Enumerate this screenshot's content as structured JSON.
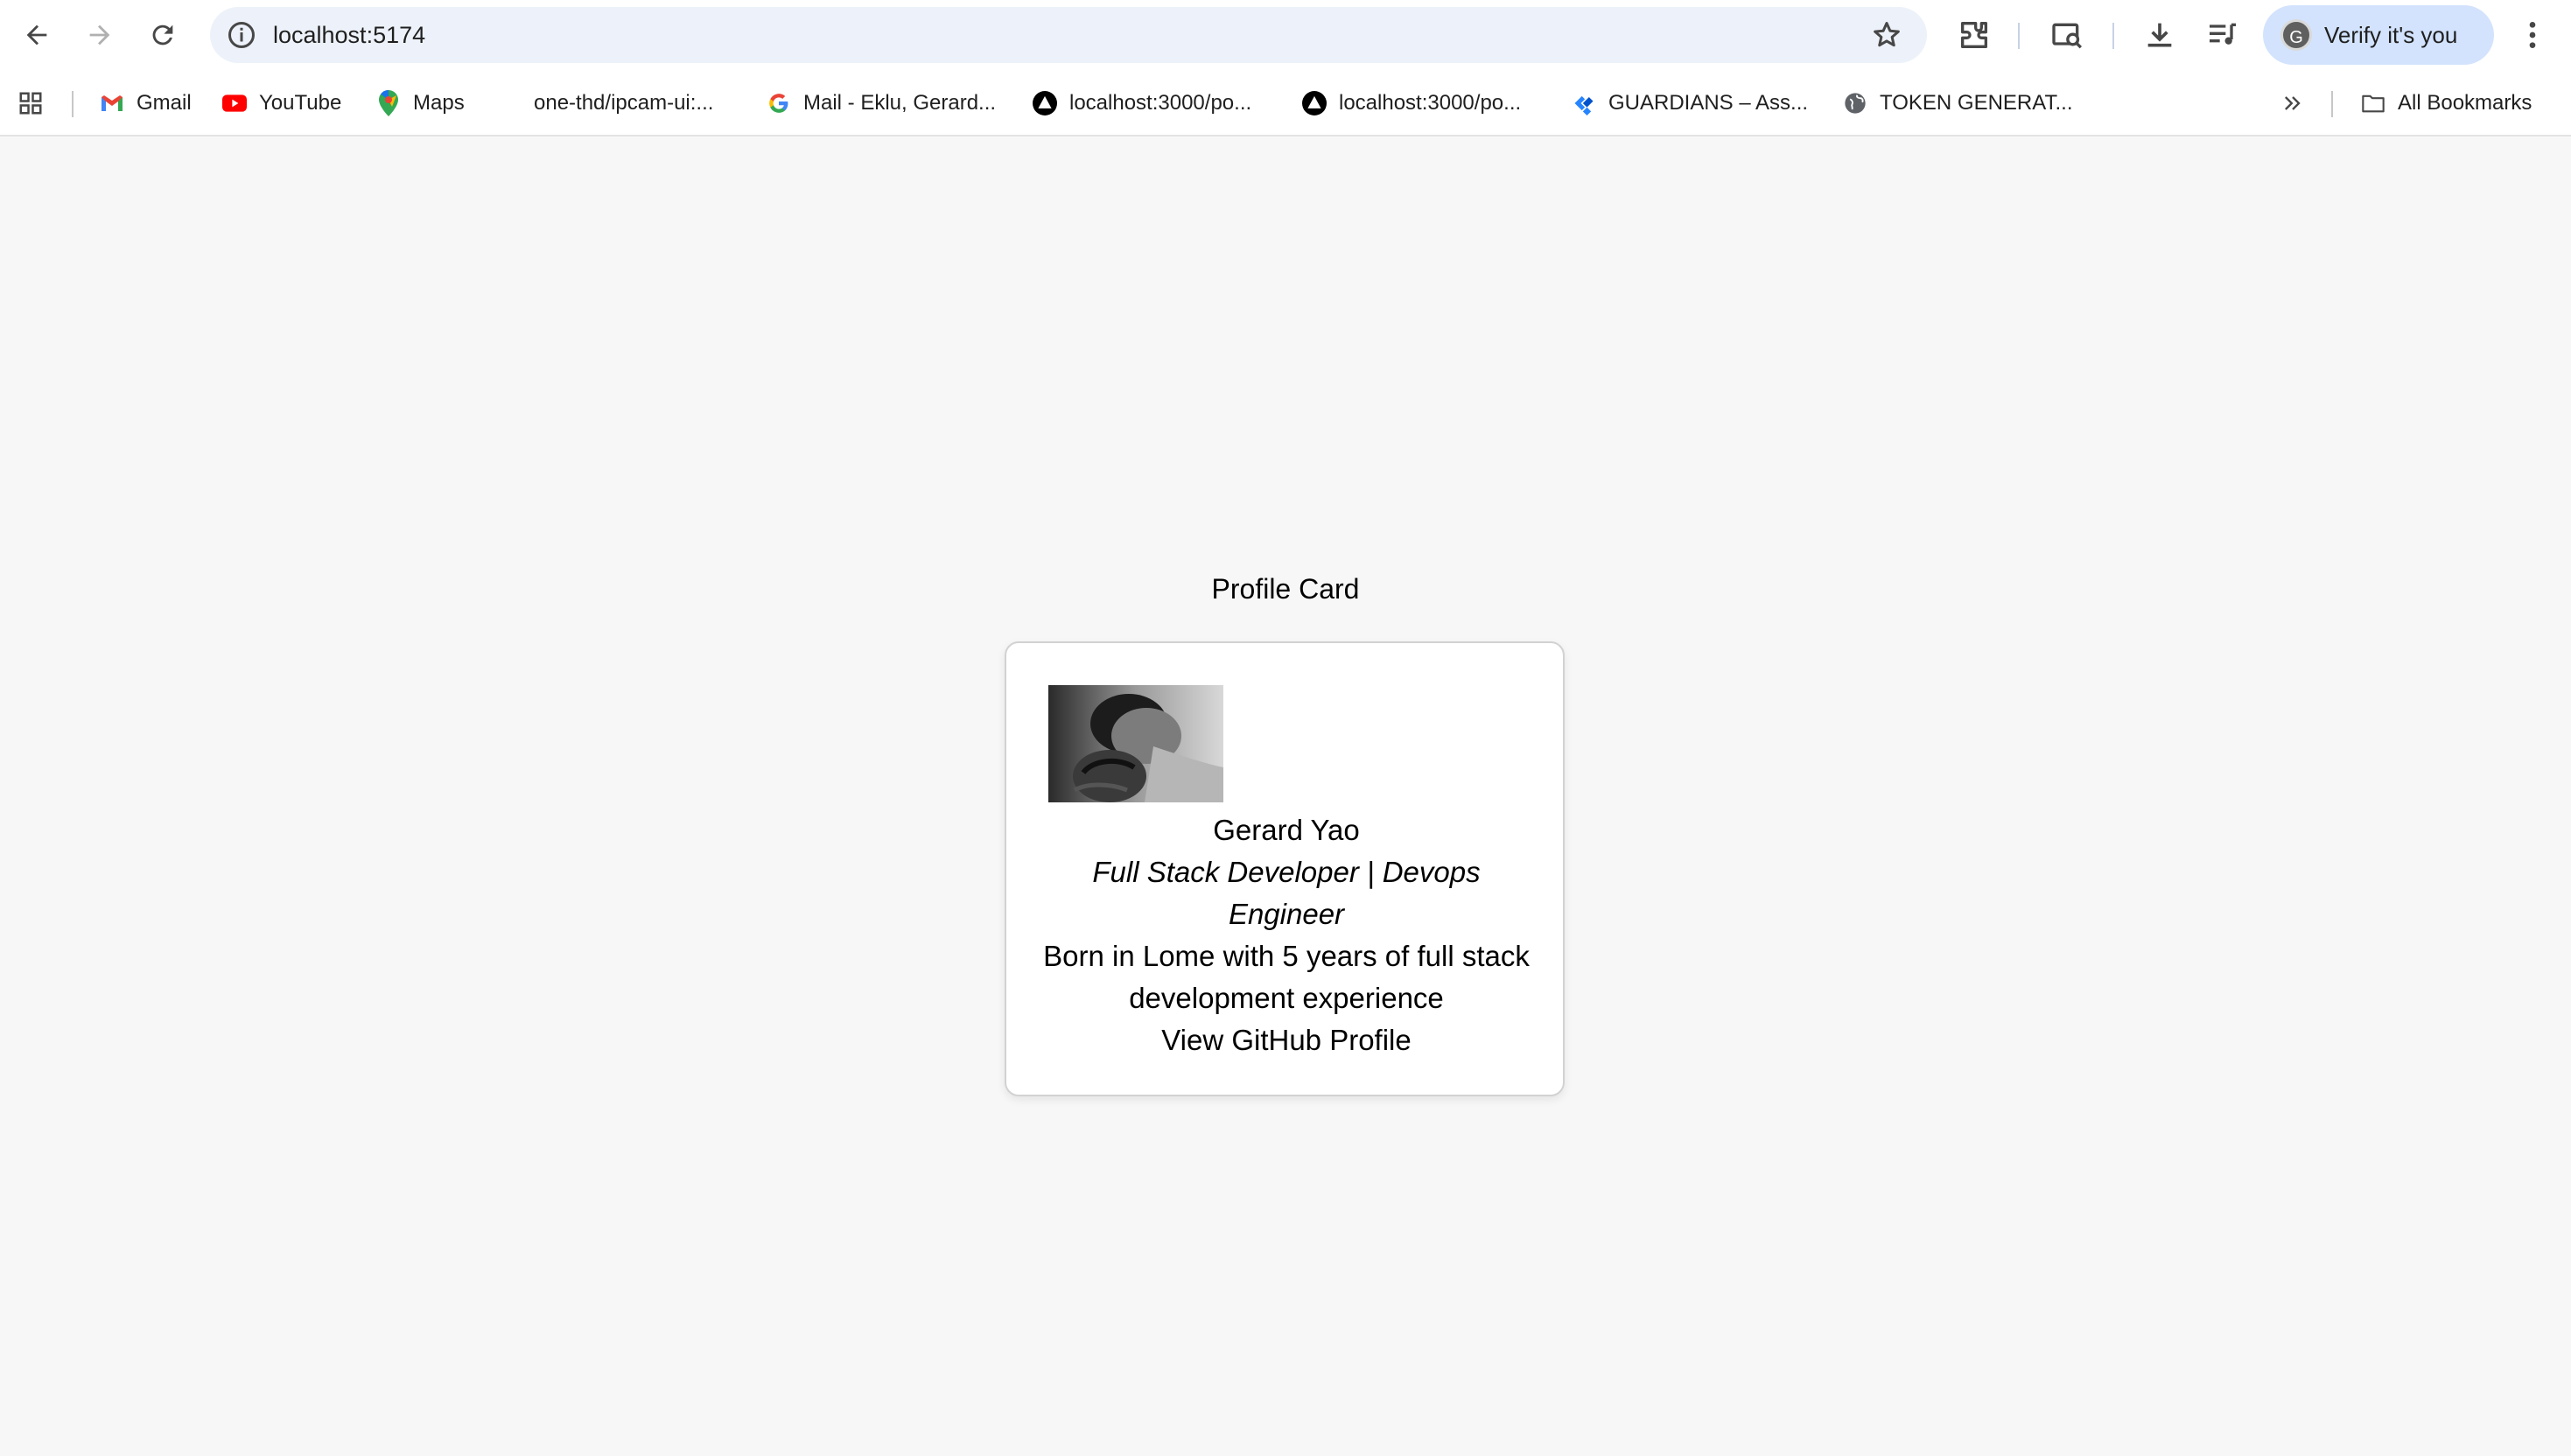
{
  "browser": {
    "url": "localhost:5174",
    "verify_label": "Verify it's you",
    "avatar_initial": "G",
    "all_bookmarks": "All Bookmarks",
    "bookmarks": [
      {
        "label": "Gmail",
        "icon": "gmail-icon"
      },
      {
        "label": "YouTube",
        "icon": "youtube-icon"
      },
      {
        "label": "Maps",
        "icon": "maps-icon"
      },
      {
        "label": "one-thd/ipcam-ui:...",
        "icon": "github-icon"
      },
      {
        "label": "Mail - Eklu, Gerard...",
        "icon": "google-icon"
      },
      {
        "label": "localhost:3000/po...",
        "icon": "triangle-icon"
      },
      {
        "label": "localhost:3000/po...",
        "icon": "triangle-icon"
      },
      {
        "label": "GUARDIANS – Ass...",
        "icon": "jira-icon"
      },
      {
        "label": "TOKEN GENERAT...",
        "icon": "globe-icon"
      }
    ]
  },
  "page": {
    "title": "Profile Card",
    "card": {
      "name": "Gerard Yao",
      "role": "Full Stack Developer | Devops Engineer",
      "bio": "Born in Lome with 5 years of full stack development experience",
      "link_label": "View GitHub Profile"
    }
  },
  "colors": {
    "omnibox_bg": "#edf2fa",
    "verify_bg": "#d3e3fd",
    "page_bg": "#f7f7f7"
  }
}
